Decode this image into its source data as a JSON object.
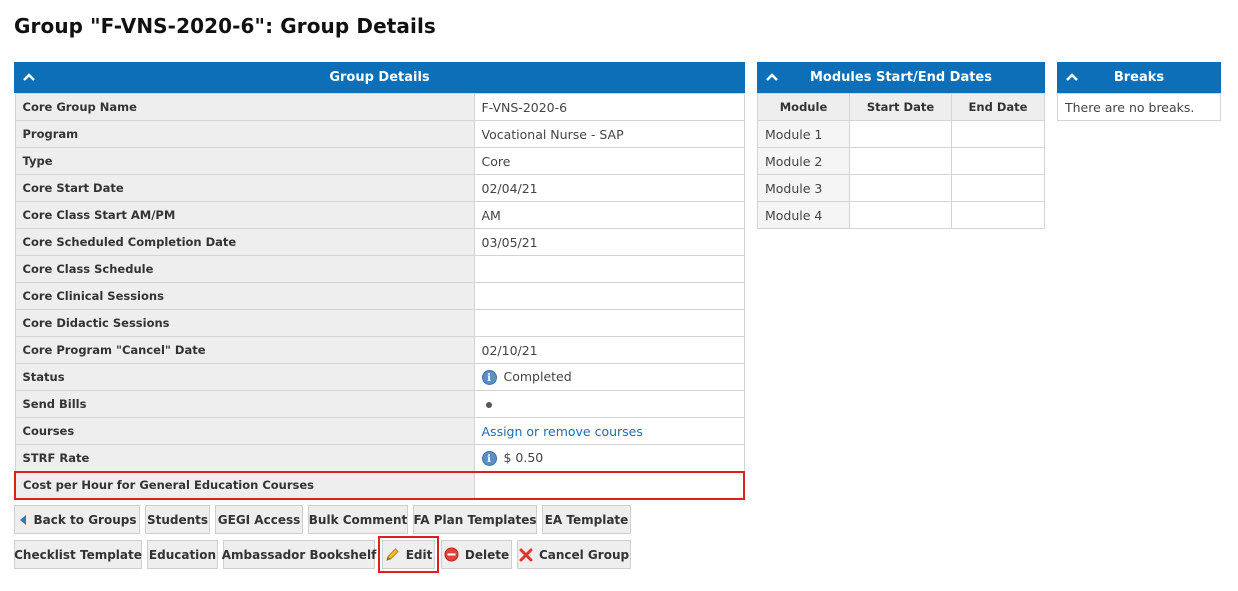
{
  "page": {
    "title": "Group \"F-VNS-2020-6\": Group Details"
  },
  "group_details": {
    "header": "Group Details",
    "rows": [
      {
        "label": "Core Group Name",
        "value": "F-VNS-2020-6"
      },
      {
        "label": "Program",
        "value": "Vocational Nurse - SAP"
      },
      {
        "label": "Type",
        "value": "Core"
      },
      {
        "label": "Core Start Date",
        "value": "02/04/21"
      },
      {
        "label": "Core Class Start AM/PM",
        "value": "AM"
      },
      {
        "label": "Core Scheduled Completion Date",
        "value": "03/05/21"
      },
      {
        "label": "Core Class Schedule",
        "value": ""
      },
      {
        "label": "Core Clinical Sessions",
        "value": ""
      },
      {
        "label": "Core Didactic Sessions",
        "value": ""
      },
      {
        "label": "Core Program \"Cancel\" Date",
        "value": "02/10/21"
      },
      {
        "label": "Status",
        "value": "Completed"
      },
      {
        "label": "Send Bills",
        "value": ""
      },
      {
        "label": "Courses",
        "value": "Assign or remove courses"
      },
      {
        "label": "STRF Rate",
        "value": "$ 0.50"
      },
      {
        "label": "Cost per Hour for General Education Courses",
        "value": ""
      }
    ]
  },
  "modules": {
    "header": "Modules Start/End Dates",
    "columns": [
      "Module",
      "Start Date",
      "End Date"
    ],
    "rows": [
      {
        "name": "Module 1",
        "start": "",
        "end": ""
      },
      {
        "name": "Module 2",
        "start": "",
        "end": ""
      },
      {
        "name": "Module 3",
        "start": "",
        "end": ""
      },
      {
        "name": "Module 4",
        "start": "",
        "end": ""
      }
    ]
  },
  "breaks": {
    "header": "Breaks",
    "empty_text": "There are no breaks."
  },
  "buttons": {
    "back": "Back to Groups",
    "students": "Students",
    "gegi": "GEGI Access",
    "bulk": "Bulk Comment",
    "fa_plan": "FA Plan Templates",
    "ea_template": "EA Template",
    "checklist": "Checklist Template",
    "education": "Education",
    "ambassador": "Ambassador Bookshelf",
    "edit": "Edit",
    "delete": "Delete",
    "cancel_group": "Cancel Group"
  },
  "icons": {
    "collapse": "chevron-up-icon",
    "info": "info-icon",
    "back": "arrow-left-icon",
    "edit": "pencil-icon",
    "delete": "minus-circle-icon",
    "cancel": "x-icon"
  },
  "colors": {
    "header_bg": "#0d6fb8",
    "highlight": "#dd1f1f",
    "link": "#1b6db5"
  }
}
